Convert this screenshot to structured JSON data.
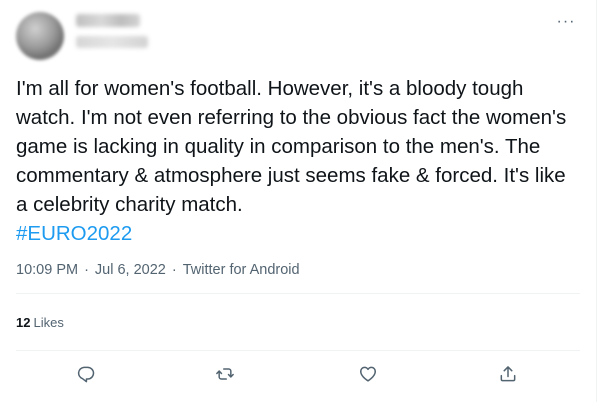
{
  "author": {
    "display_name": "",
    "handle": ""
  },
  "tweet": {
    "text": "I'm all for women's football. However, it's a bloody tough watch. I'm not even referring to the obvious fact the women's game is lacking in quality in comparison to the men's. The commentary & atmosphere just seems fake & forced. It's like a celebrity charity match.",
    "hashtag": "#EURO2022",
    "time": "10:09 PM",
    "date": "Jul 6, 2022",
    "source": "Twitter for Android",
    "separator": "·"
  },
  "stats": {
    "likes_count": "12",
    "likes_label": "Likes"
  },
  "actions": [
    {
      "name": "reply",
      "icon": "reply-icon"
    },
    {
      "name": "retweet",
      "icon": "retweet-icon"
    },
    {
      "name": "like",
      "icon": "heart-icon"
    },
    {
      "name": "share",
      "icon": "share-icon"
    }
  ],
  "menu": {
    "more_icon": "more-horizontal-icon"
  },
  "colors": {
    "text": "#0f1419",
    "secondary": "#536471",
    "link": "#1d9bf0",
    "divider": "#eff3f4"
  }
}
